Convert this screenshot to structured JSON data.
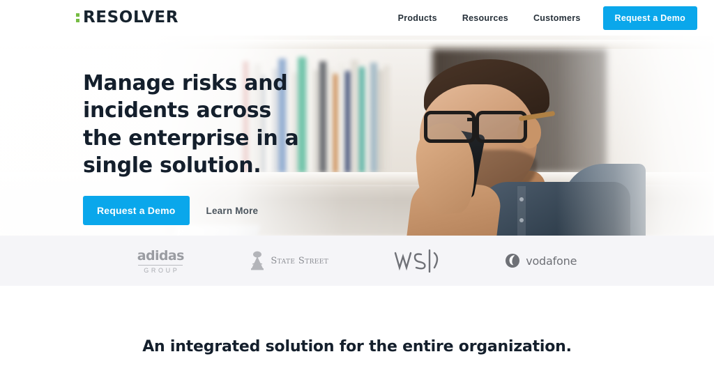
{
  "header": {
    "brand": {
      "name": "RESOLVER",
      "mark": "green-squares-icon"
    },
    "nav": [
      {
        "label": "Products"
      },
      {
        "label": "Resources"
      },
      {
        "label": "Customers"
      }
    ],
    "cta_label": "Request a Demo"
  },
  "hero": {
    "title": "Manage risks and incidents across the enterprise in a single solution.",
    "primary_cta": "Request a Demo",
    "secondary_cta": "Learn More",
    "image_alt": "Man with glasses in denim shirt talking on a mobile phone in front of a bookshelf"
  },
  "clients": {
    "logos": [
      {
        "name": "adidas",
        "word": "adidas",
        "sub": "GROUP"
      },
      {
        "name": "state-street",
        "word": "State Street"
      },
      {
        "name": "wsp",
        "word": "WSP"
      },
      {
        "name": "vodafone",
        "word": "vodafone"
      }
    ]
  },
  "section": {
    "heading": "An integrated solution for the entire organization."
  },
  "colors": {
    "accent_blue": "#0aa7eb",
    "brand_green": "#76bc43",
    "ink": "#141f2c",
    "logo_bar_bg": "#f5f5f8"
  }
}
